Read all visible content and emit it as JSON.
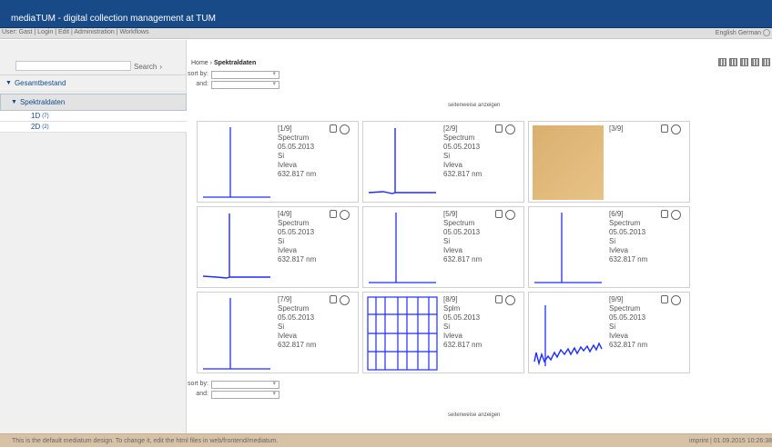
{
  "header": {
    "title": "mediaTUM - digital collection management at TUM"
  },
  "user_bar": {
    "links": "User: Gast | Login | Edit | Administration | Workflows",
    "languages": "English German"
  },
  "sidebar": {
    "search_button": "Search",
    "nav": [
      {
        "label": "Gesamtbestand"
      },
      {
        "label": "Spektraldaten"
      }
    ],
    "sub_items": [
      {
        "label": "1D",
        "count": "(7)"
      },
      {
        "label": "2D",
        "count": "(2)"
      }
    ]
  },
  "content": {
    "breadcrumb_home": "Home",
    "breadcrumb_sep": "›",
    "breadcrumb_current": "Spektraldaten",
    "sort_by_label": "sort by:",
    "and_label": "and:",
    "pager_text": "seitenweise anzeigen"
  },
  "items": [
    {
      "index": "[1/9]",
      "type": "Spectrum",
      "date": "05.05.2013",
      "material": "Si",
      "author": "Ivleva",
      "wavelength": "632.817 nm"
    },
    {
      "index": "[2/9]",
      "type": "Spectrum",
      "date": "05.05.2013",
      "material": "Si",
      "author": "Ivleva",
      "wavelength": "632.817 nm"
    },
    {
      "index": "[3/9]",
      "type": "",
      "date": "",
      "material": "",
      "author": "",
      "wavelength": ""
    },
    {
      "index": "[4/9]",
      "type": "Spectrum",
      "date": "05.05.2013",
      "material": "Si",
      "author": "Ivleva",
      "wavelength": "632.817 nm"
    },
    {
      "index": "[5/9]",
      "type": "Spectrum",
      "date": "05.05.2013",
      "material": "Si",
      "author": "Ivleva",
      "wavelength": "632.817 nm"
    },
    {
      "index": "[6/9]",
      "type": "Spectrum",
      "date": "05.05.2013",
      "material": "Si",
      "author": "Ivleva",
      "wavelength": "632.817 nm"
    },
    {
      "index": "[7/9]",
      "type": "Spectrum",
      "date": "05.05.2013",
      "material": "Si",
      "author": "Ivleva",
      "wavelength": "632.817 nm"
    },
    {
      "index": "[8/9]",
      "type": "Splm",
      "date": "05.05.2013",
      "material": "Si",
      "author": "Ivleva",
      "wavelength": "632.817 nm"
    },
    {
      "index": "[9/9]",
      "type": "Spectrum",
      "date": "05.05.2013",
      "material": "Si",
      "author": "Ivleva",
      "wavelength": "632.817 nm"
    }
  ],
  "footer": {
    "left": "This is the default mediatum design. To change it, edit the html files in web/frontend/mediatum.",
    "right": "imprint | 01.09.2015 10:26:38"
  }
}
